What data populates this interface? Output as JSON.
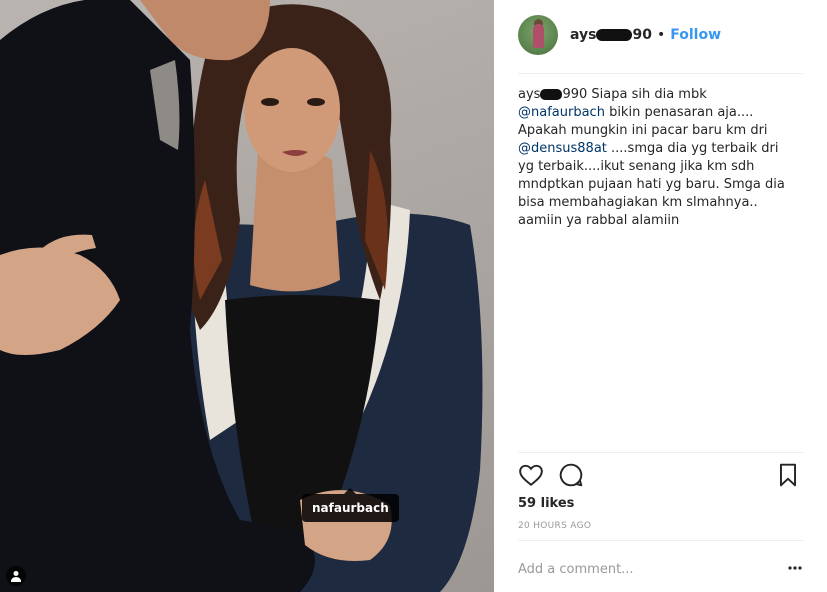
{
  "post": {
    "photo_tag": "nafaurbach",
    "username_prefix": "ays",
    "username_suffix": "90",
    "follow_label": "Follow",
    "separator": "•"
  },
  "caption": {
    "user_prefix": "ays",
    "user_suffix": "990",
    "part1": " Siapa sih dia mbk ",
    "mention1": "@nafaurbach",
    "part2": " bikin penasaran aja.... Apakah mungkin ini pacar baru km dri ",
    "mention2": "@densus88at",
    "part3": " ....smga dia yg terbaik dri yg terbaik....ikut senang jika km sdh mndptkan pujaan hati yg baru. Smga dia bisa membahagiakan km slmahnya.. aamiin ya rabbal alamiin"
  },
  "engagement": {
    "likes": "59 likes",
    "timestamp": "20 HOURS AGO"
  },
  "comment": {
    "placeholder": "Add a comment..."
  },
  "icons": {
    "like": "heart-icon",
    "comment": "comment-bubble-icon",
    "save": "bookmark-icon",
    "more": "more-options-icon",
    "tag": "user-tag-icon"
  },
  "colors": {
    "link": "#3897f0",
    "mention": "#003569",
    "muted": "#999999"
  }
}
